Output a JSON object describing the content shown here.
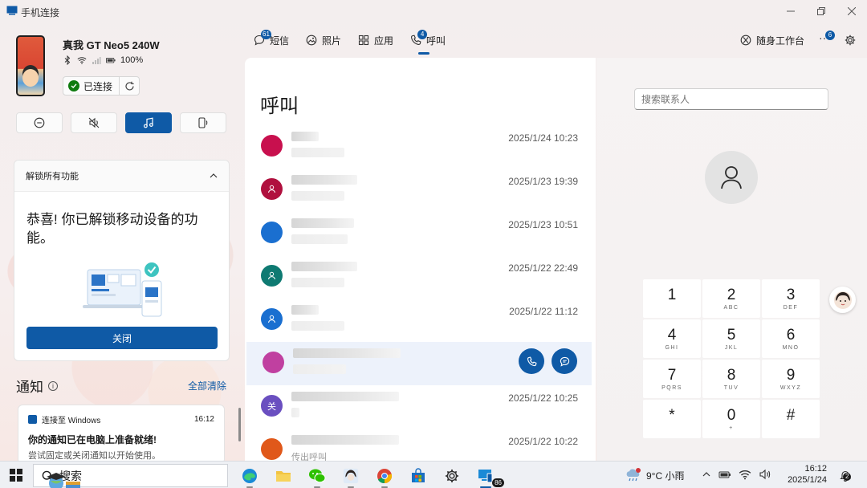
{
  "window": {
    "title": "手机连接",
    "controls": [
      "minimize",
      "restore",
      "close"
    ]
  },
  "device": {
    "name": "真我 GT Neo5 240W",
    "battery": "100%",
    "connection_label": "已连接",
    "status_icons": [
      "bluetooth-icon",
      "wifi-icon",
      "signal-icon",
      "battery-icon"
    ]
  },
  "quick_actions": [
    {
      "name": "do-not-disturb",
      "icon": "minus-circle-icon",
      "active": false
    },
    {
      "name": "mute",
      "icon": "mute-icon",
      "active": false
    },
    {
      "name": "media",
      "icon": "music-icon",
      "active": true
    },
    {
      "name": "audio-output",
      "icon": "phone-speaker-icon",
      "active": false
    }
  ],
  "unlock_card": {
    "header": "解锁所有功能",
    "message": "恭喜! 你已解锁移动设备的功能。",
    "close_label": "关闭"
  },
  "notifications": {
    "title": "通知",
    "clear_all": "全部清除",
    "items": [
      {
        "app": "连接至 Windows",
        "time": "16:12",
        "title": "你的通知已在电脑上准备就绪!",
        "body": "尝试固定或关闭通知以开始使用。"
      }
    ]
  },
  "tabs": [
    {
      "label": "短信",
      "icon": "message-icon",
      "badge": "61"
    },
    {
      "label": "照片",
      "icon": "photo-icon",
      "badge": ""
    },
    {
      "label": "应用",
      "icon": "apps-icon",
      "badge": ""
    },
    {
      "label": "呼叫",
      "icon": "call-icon",
      "badge": "4",
      "active": true
    }
  ],
  "right_nav": {
    "companion_label": "随身工作台",
    "more_badge": "6"
  },
  "calls": {
    "title": "呼叫",
    "entries": [
      {
        "time": "2025/1/24 10:23",
        "avatar_color": "#c8104e",
        "avatar_text": "",
        "sub_text": ""
      },
      {
        "time": "2025/1/23 19:39",
        "avatar_color": "#b0103e",
        "avatar_text": "",
        "sub_text": ""
      },
      {
        "time": "2025/1/23 10:51",
        "avatar_color": "#1a6fd0",
        "avatar_text": "",
        "sub_text": ""
      },
      {
        "time": "2025/1/22 22:49",
        "avatar_color": "#0e7a72",
        "avatar_text": "",
        "sub_text": ""
      },
      {
        "time": "2025/1/22 11:12",
        "avatar_color": "#1a6fd0",
        "avatar_text": "",
        "sub_text": ""
      },
      {
        "time": "",
        "avatar_color": "#c040a0",
        "avatar_text": "",
        "sub_text": "",
        "highlighted": true
      },
      {
        "time": "2025/1/22 10:25",
        "avatar_color": "#6a4fc0",
        "avatar_text": "关",
        "sub_text": ""
      },
      {
        "time": "2025/1/22 10:22",
        "avatar_color": "#e0581a",
        "avatar_text": "",
        "sub_text": "传出呼叫"
      }
    ]
  },
  "dialer": {
    "search_placeholder": "搜索联系人",
    "keys": [
      {
        "digit": "1",
        "letters": ""
      },
      {
        "digit": "2",
        "letters": "ABC"
      },
      {
        "digit": "3",
        "letters": "DEF"
      },
      {
        "digit": "4",
        "letters": "GHI"
      },
      {
        "digit": "5",
        "letters": "JKL"
      },
      {
        "digit": "6",
        "letters": "MNO"
      },
      {
        "digit": "7",
        "letters": "PQRS"
      },
      {
        "digit": "8",
        "letters": "TUV"
      },
      {
        "digit": "9",
        "letters": "WXYZ"
      },
      {
        "digit": "*",
        "letters": ""
      },
      {
        "digit": "0",
        "letters": "+"
      },
      {
        "digit": "#",
        "letters": ""
      }
    ]
  },
  "taskbar": {
    "search_label": "搜索",
    "weather": "9°C 小雨",
    "clock_time": "16:12",
    "clock_date": "2025/1/24",
    "app_badge": "86",
    "notif_badge": "2"
  },
  "colors": {
    "accent": "#0f5aa6",
    "connected_green": "#0f7b0f",
    "selected_row": "#edf2fb"
  }
}
